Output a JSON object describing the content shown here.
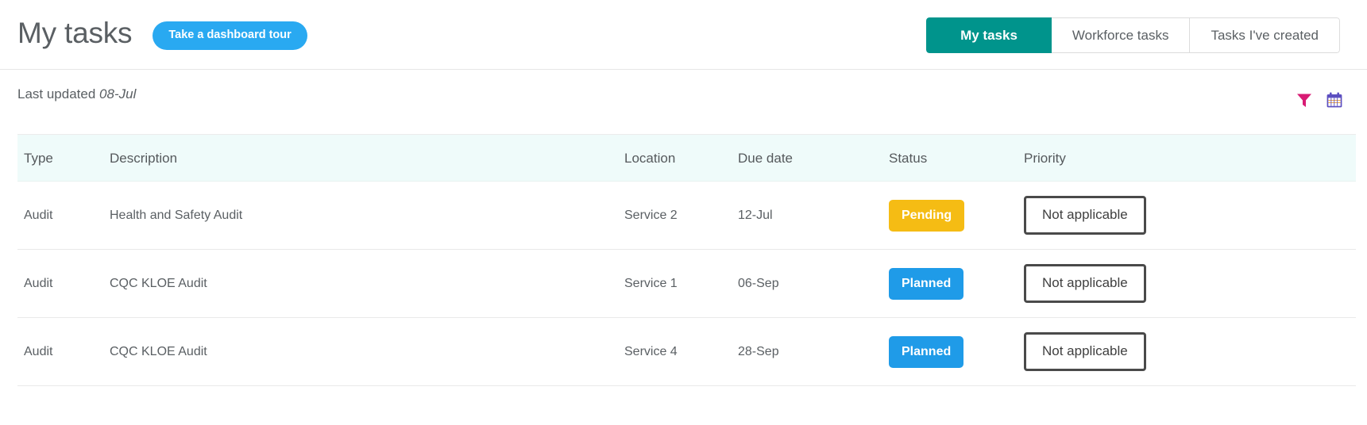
{
  "header": {
    "title": "My tasks",
    "tour_button_label": "Take a dashboard tour",
    "tabs": [
      {
        "label": "My tasks",
        "active": true
      },
      {
        "label": "Workforce tasks",
        "active": false
      },
      {
        "label": "Tasks I've created",
        "active": false
      }
    ]
  },
  "subbar": {
    "last_updated_label": "Last updated",
    "last_updated_date": "08-Jul",
    "icons": [
      {
        "name": "filter-icon",
        "color": "#d81b74"
      },
      {
        "name": "calendar-icon",
        "color": "#5c4fc0"
      }
    ]
  },
  "table": {
    "columns": [
      "Type",
      "Description",
      "Location",
      "Due date",
      "Status",
      "Priority"
    ],
    "rows": [
      {
        "type": "Audit",
        "description": "Health and Safety Audit",
        "location": "Service 2",
        "due_date": "12-Jul",
        "status": "Pending",
        "status_color": "#f5bc14",
        "priority": "Not applicable"
      },
      {
        "type": "Audit",
        "description": "CQC KLOE Audit",
        "location": "Service 1",
        "due_date": "06-Sep",
        "status": "Planned",
        "status_color": "#1f9be8",
        "priority": "Not applicable"
      },
      {
        "type": "Audit",
        "description": "CQC KLOE Audit",
        "location": "Service 4",
        "due_date": "28-Sep",
        "status": "Planned",
        "status_color": "#1f9be8",
        "priority": "Not applicable"
      }
    ]
  },
  "theme": {
    "accent_teal": "#00948c",
    "accent_blue": "#29a9f1",
    "header_row_bg": "#effbfa"
  }
}
